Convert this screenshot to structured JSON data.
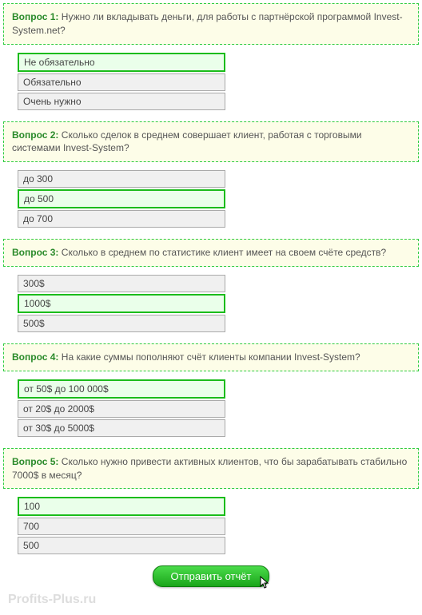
{
  "questions": [
    {
      "label": "Вопрос 1:",
      "text": "Нужно ли вкладывать деньги, для работы с партнёрской программой Invest-System.net?",
      "options": [
        {
          "text": "Не обязательно",
          "selected": true
        },
        {
          "text": "Обязательно",
          "selected": false
        },
        {
          "text": "Очень нужно",
          "selected": false
        }
      ]
    },
    {
      "label": "Вопрос 2:",
      "text": "Сколько сделок в среднем совершает клиент, работая с торговыми системами Invest-System?",
      "options": [
        {
          "text": "до 300",
          "selected": false
        },
        {
          "text": "до 500",
          "selected": true
        },
        {
          "text": "до 700",
          "selected": false
        }
      ]
    },
    {
      "label": "Вопрос 3:",
      "text": "Сколько в среднем по статистике клиент имеет на своем счёте средств?",
      "options": [
        {
          "text": "300$",
          "selected": false
        },
        {
          "text": "1000$",
          "selected": true
        },
        {
          "text": "500$",
          "selected": false
        }
      ]
    },
    {
      "label": "Вопрос 4:",
      "text": "На какие суммы пополняют счёт клиенты компании Invest-System?",
      "options": [
        {
          "text": "от 50$ до 100 000$",
          "selected": true
        },
        {
          "text": "от 20$ до 2000$",
          "selected": false
        },
        {
          "text": "от 30$ до 5000$",
          "selected": false
        }
      ]
    },
    {
      "label": "Вопрос 5:",
      "text": "Сколько нужно привести активных клиентов, что бы зарабатывать стабильно 7000$ в месяц?",
      "options": [
        {
          "text": "100",
          "selected": true
        },
        {
          "text": "700",
          "selected": false
        },
        {
          "text": "500",
          "selected": false
        }
      ]
    }
  ],
  "submit_label": "Отправить отчёт",
  "cursor_glyph": "↖",
  "watermark": "Profits-Plus.ru"
}
